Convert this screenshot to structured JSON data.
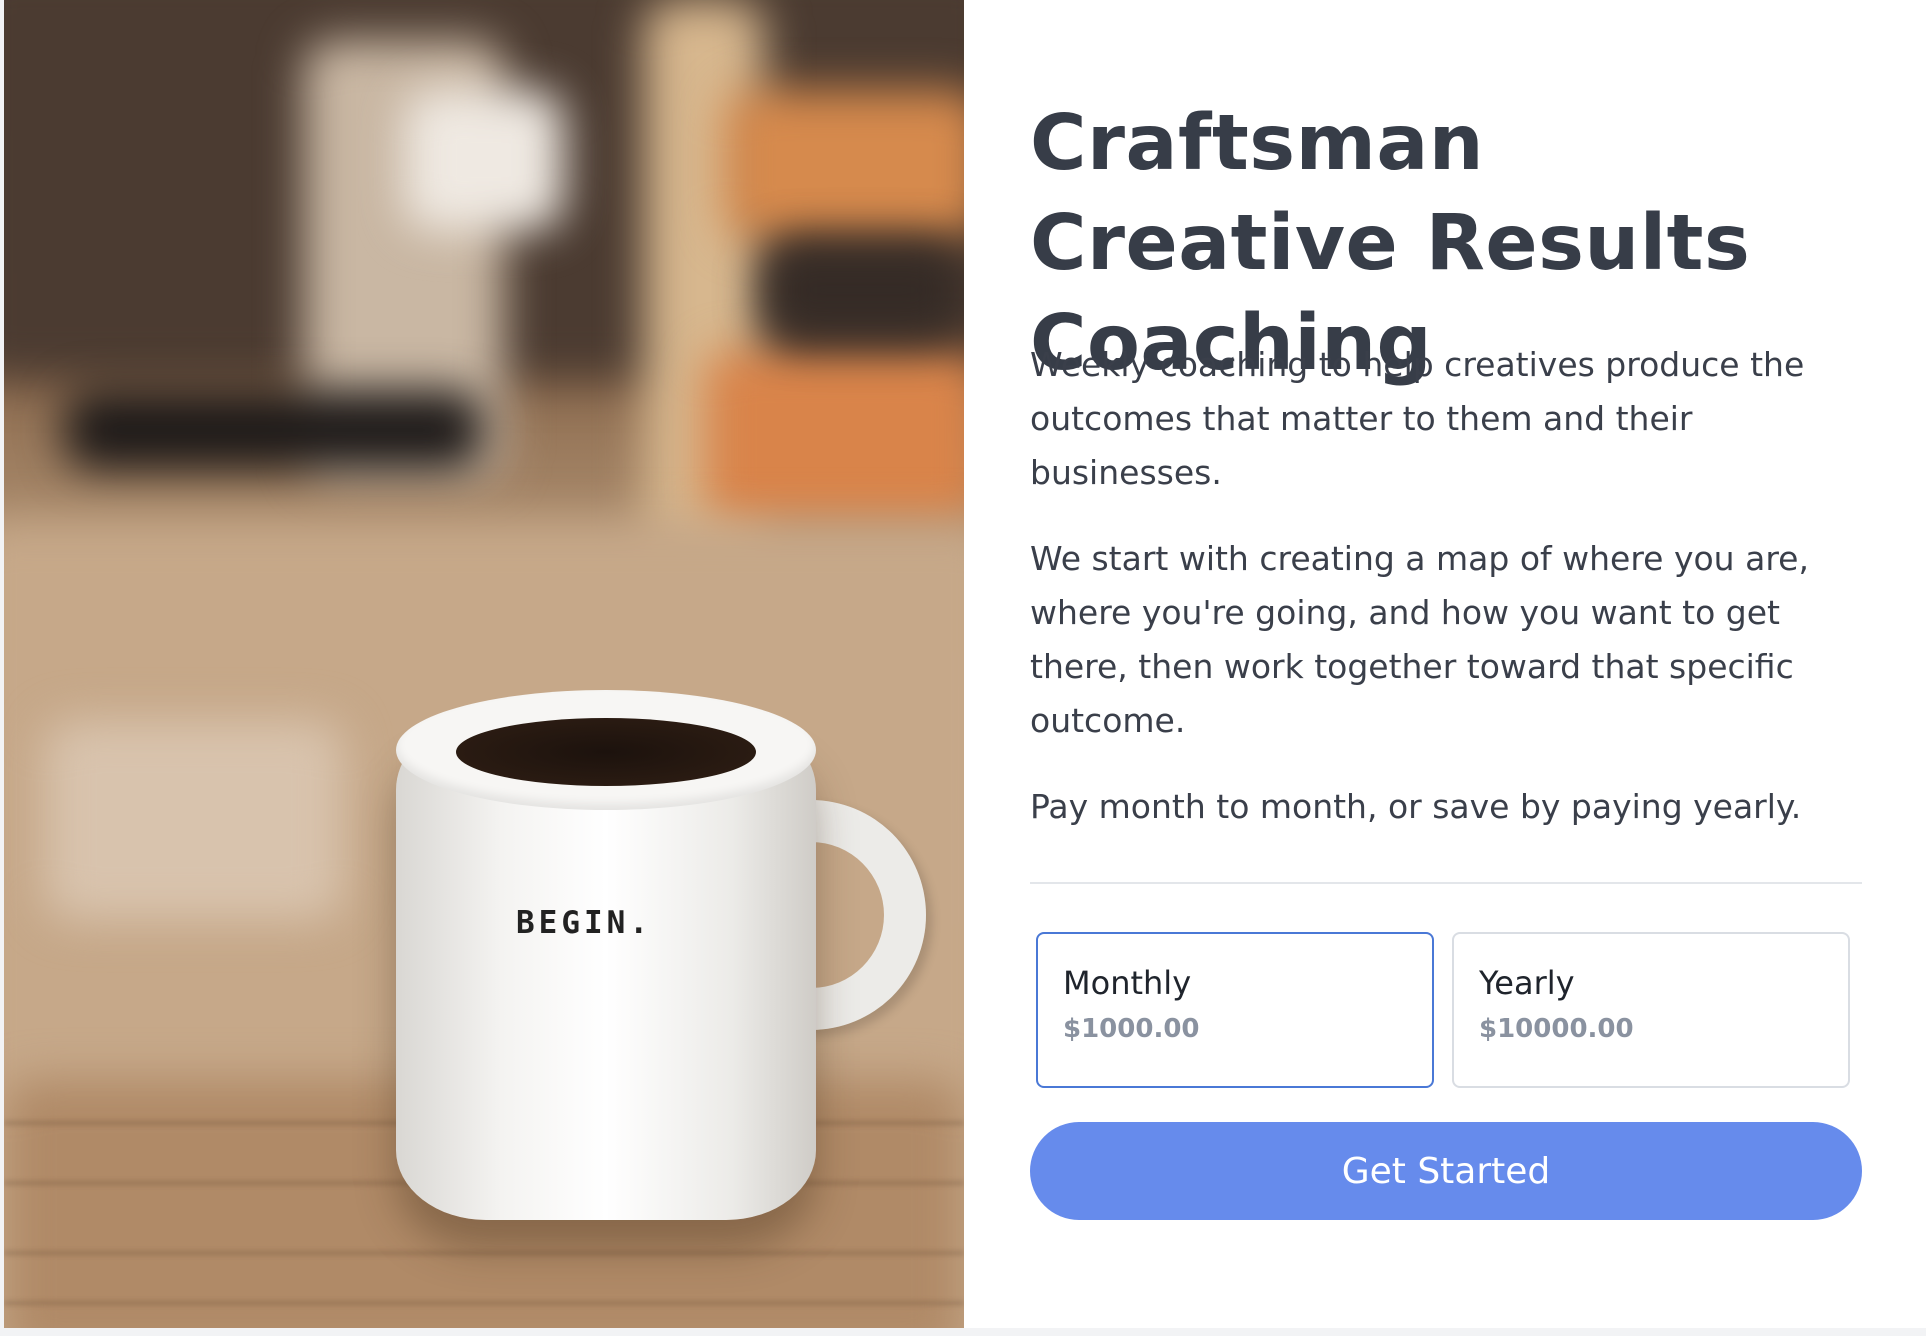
{
  "product": {
    "title": "Craftsman Creative Results Coaching",
    "description": [
      "Weekly coaching to help creatives produce the outcomes that matter to them and their businesses.",
      "We start with creating a map of where you are, where you're going, and how you want to get there, then work together toward that specific outcome.",
      "Pay month to month, or save by paying yearly."
    ]
  },
  "hero_image": {
    "mug_text": "BEGIN."
  },
  "plans": [
    {
      "name": "Monthly",
      "price": "$1000.00",
      "selected": true
    },
    {
      "name": "Yearly",
      "price": "$10000.00",
      "selected": false
    }
  ],
  "cta": {
    "label": "Get Started"
  },
  "colors": {
    "accent": "#668bec",
    "selected_border": "#4a78d6",
    "title": "#373d48",
    "price": "#8a92a0"
  }
}
